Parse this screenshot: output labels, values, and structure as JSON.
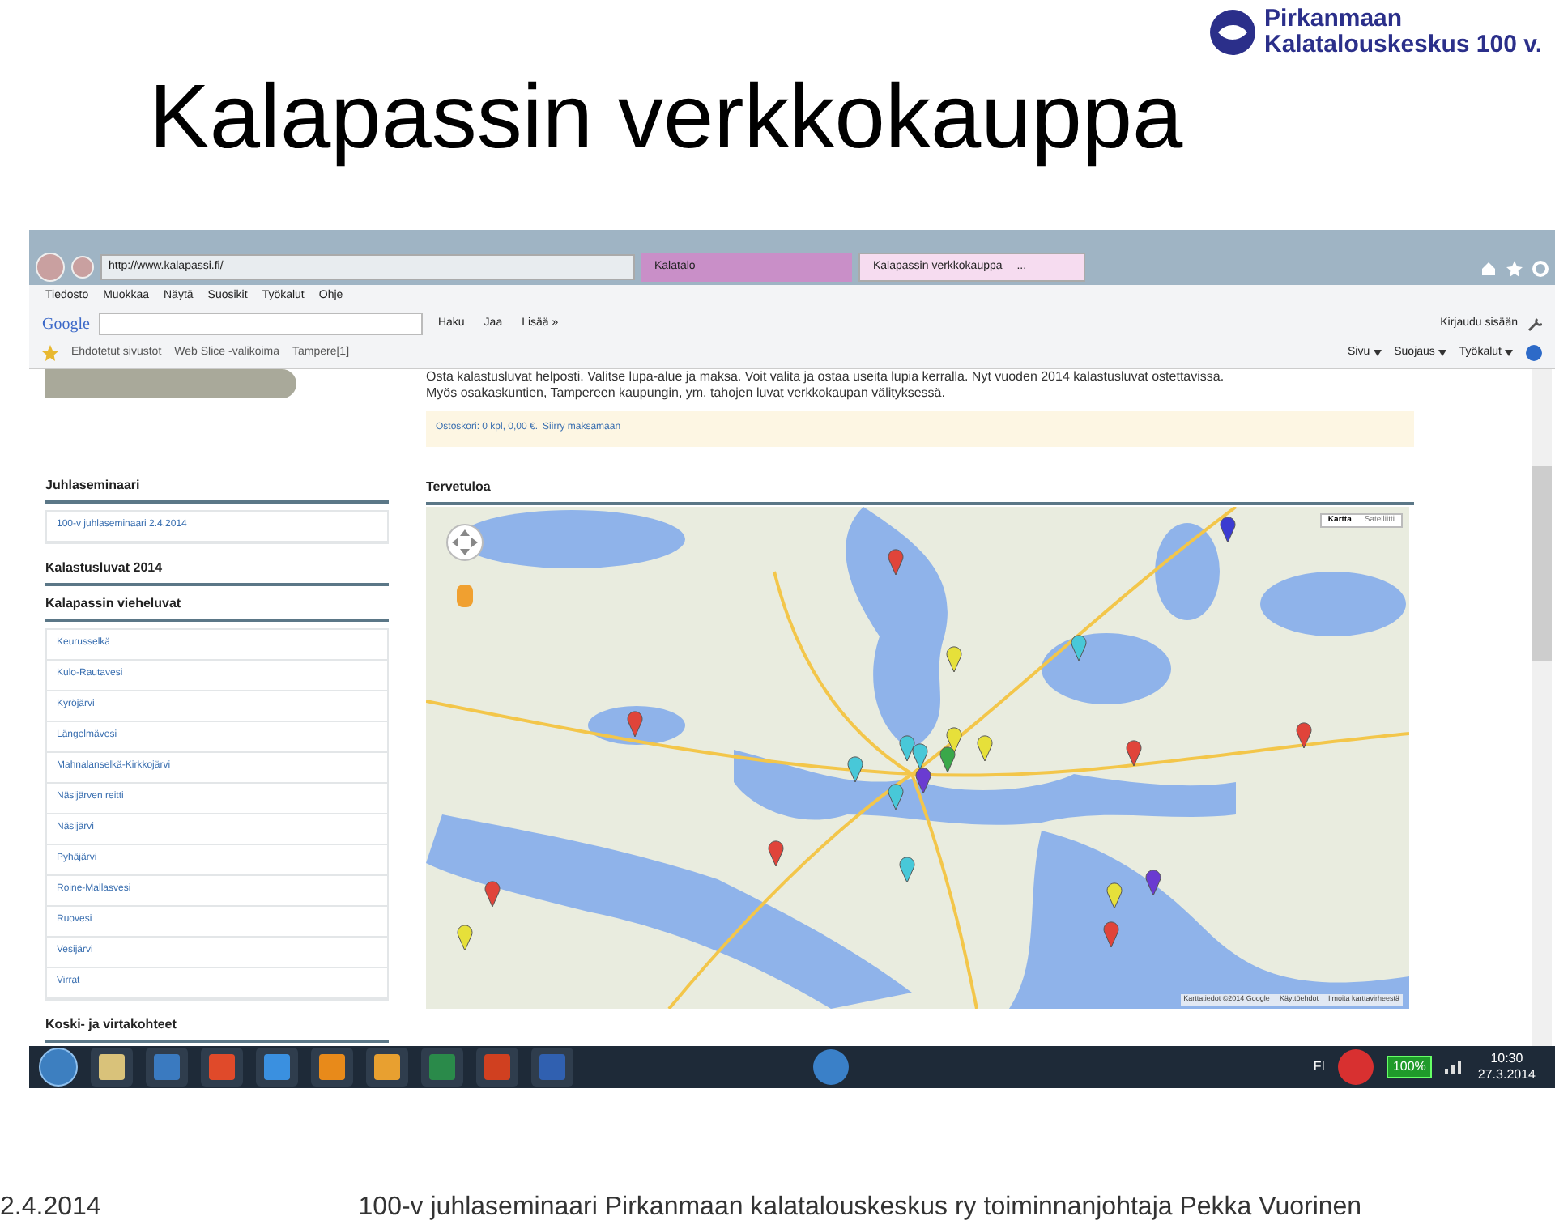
{
  "slide": {
    "title": "Kalapassin verkkokauppa",
    "logo": {
      "line_1": "Pirkanmaan",
      "line_2": "Kalatalouskeskus 100 v."
    }
  },
  "browser": {
    "address": "http://www.kalapassi.fi/",
    "tabs": [
      {
        "label": "Kalatalo",
        "selected": false
      },
      {
        "label": "Kalapassin verkkokauppa —...",
        "selected": true
      }
    ],
    "menu": [
      "Tiedosto",
      "Muokkaa",
      "Näytä",
      "Suosikit",
      "Työkalut",
      "Ohje"
    ],
    "google_toolbar": {
      "logo": "Google",
      "buttons": [
        "Haku",
        "Jaa",
        "Lisää »"
      ],
      "sign_in": "Kirjaudu sisään"
    },
    "favorites_bar": {
      "items": [
        "Ehdotetut sivustot",
        "Web Slice -valikoima",
        "Tampere[1]"
      ],
      "commands": [
        "Sivu",
        "Suojaus",
        "Työkalut"
      ]
    }
  },
  "page": {
    "intro": [
      "Osta kalastusluvat helposti. Valitse lupa-alue ja maksa. Voit valita ja ostaa useita lupia kerralla. Nyt vuoden 2014 kalastusluvat ostettavissa.",
      "Myös osakaskuntien, Tampereen kaupungin, ym. tahojen luvat verkkokaupan välityksessä."
    ],
    "cart": {
      "text": "Ostoskori: 0 kpl, 0,00 €.",
      "link": "Siirry maksamaan"
    },
    "sidebar": [
      {
        "heading": "Juhlaseminaari",
        "items": [
          "100-v juhlaseminaari 2.4.2014"
        ]
      },
      {
        "heading": "Kalastusluvat 2014"
      },
      {
        "heading": "Kalapassin vieheluvat",
        "items": [
          "Keurusselkä",
          "Kulo-Rautavesi",
          "Kyröjärvi",
          "Längelmävesi",
          "Mahnalanselkä-Kirkkojärvi",
          "Näsijärven reitti",
          "Näsijärvi",
          "Pyhäjärvi",
          "Roine-Mallasvesi",
          "Ruovesi",
          "Vesijärvi",
          "Virrat"
        ]
      },
      {
        "heading": "Koski- ja virtakohteet"
      }
    ],
    "map": {
      "heading": "Tervetuloa",
      "map_types": [
        {
          "label": "Kartta",
          "selected": true
        },
        {
          "label": "Satelliitti",
          "selected": false
        }
      ],
      "attribution": [
        "Karttatiedot ©2014 Google",
        "Käyttöehdot",
        "Ilmoita karttavirheestä"
      ]
    }
  },
  "taskbar": {
    "language": "FI",
    "battery": "100%",
    "time": "10:30",
    "date": "27.3.2014"
  },
  "footer": {
    "date": "2.4.2014",
    "caption": "100-v juhlaseminaari Pirkanmaan kalatalouskeskus ry toiminnanjohtaja Pekka Vuorinen"
  }
}
